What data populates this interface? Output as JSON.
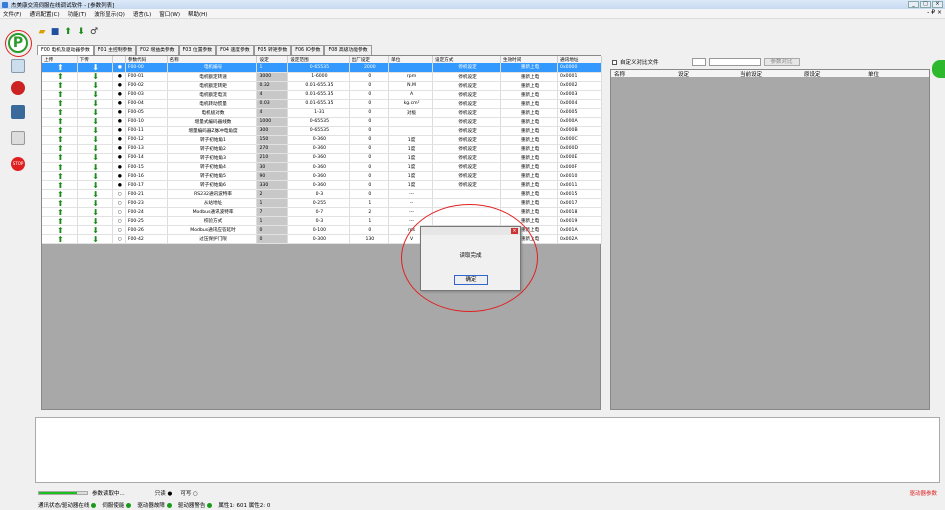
{
  "window": {
    "title": "杰美康交流伺服在线调试软件 - [参数列表]",
    "buttons": [
      "_",
      "□",
      "×"
    ]
  },
  "menu": [
    "文件(F)",
    "通讯配置(C)",
    "功能(T)",
    "波形显示(Q)",
    "语言(L)",
    "窗口(W)",
    "帮助(H)"
  ],
  "menu_right": "- ₽ ×",
  "tabs": [
    "F00 电机及驱动器参数",
    "F01 主控制参数",
    "F02 增益类参数",
    "F03 位置参数",
    "F04 速度参数",
    "F05 转矩参数",
    "F06 IO参数",
    "F08 高级功能参数"
  ],
  "columns": [
    "上传",
    "下传",
    "",
    "参数代码",
    "名称",
    "设定",
    "设定范围",
    "出厂设定",
    "单位",
    "设定方式",
    "生效时间",
    "通讯地址"
  ],
  "rows": [
    {
      "code": "F00-00",
      "name": "电机编号",
      "value": "1",
      "range": "0-65535",
      "default": "2000",
      "unit": "",
      "mode": "停机设定",
      "effect": "重新上电",
      "addr": "0x0000",
      "dot": "●"
    },
    {
      "code": "F00-01",
      "name": "电机额定转速",
      "value": "3000",
      "range": "1-6000",
      "default": "0",
      "unit": "rpm",
      "mode": "停机设定",
      "effect": "重新上电",
      "addr": "0x0001",
      "dot": "●"
    },
    {
      "code": "F00-02",
      "name": "电机额定转矩",
      "value": "0.32",
      "range": "0.01-655.35",
      "default": "0",
      "unit": "N.M",
      "mode": "停机设定",
      "effect": "重新上电",
      "addr": "0x0002",
      "dot": "●"
    },
    {
      "code": "F00-03",
      "name": "电机额定电流",
      "value": "4",
      "range": "0.01-655.35",
      "default": "0",
      "unit": "A",
      "mode": "停机设定",
      "effect": "重新上电",
      "addr": "0x0003",
      "dot": "●"
    },
    {
      "code": "F00-04",
      "name": "电机转动惯量",
      "value": "0.03",
      "range": "0.01-655.35",
      "default": "0",
      "unit": "kg.cm²",
      "mode": "停机设定",
      "effect": "重新上电",
      "addr": "0x0004",
      "dot": "●"
    },
    {
      "code": "F00-05",
      "name": "电机极对数",
      "value": "4",
      "range": "1-31",
      "default": "0",
      "unit": "对极",
      "mode": "停机设定",
      "effect": "重新上电",
      "addr": "0x0005",
      "dot": "●"
    },
    {
      "code": "F00-10",
      "name": "增量式编码器线数",
      "value": "1000",
      "range": "0-65535",
      "default": "0",
      "unit": "",
      "mode": "停机设定",
      "effect": "重新上电",
      "addr": "0x000A",
      "dot": "●"
    },
    {
      "code": "F00-11",
      "name": "增量编码器Z脉冲电角度",
      "value": "300",
      "range": "0-65535",
      "default": "0",
      "unit": "",
      "mode": "停机设定",
      "effect": "重新上电",
      "addr": "0x000B",
      "dot": "●"
    },
    {
      "code": "F00-12",
      "name": "转子初始角1",
      "value": "150",
      "range": "0-360",
      "default": "0",
      "unit": "1度",
      "mode": "停机设定",
      "effect": "重新上电",
      "addr": "0x000C",
      "dot": "●"
    },
    {
      "code": "F00-13",
      "name": "转子初始角2",
      "value": "270",
      "range": "0-360",
      "default": "0",
      "unit": "1度",
      "mode": "停机设定",
      "effect": "重新上电",
      "addr": "0x000D",
      "dot": "●"
    },
    {
      "code": "F00-14",
      "name": "转子初始角3",
      "value": "210",
      "range": "0-360",
      "default": "0",
      "unit": "1度",
      "mode": "停机设定",
      "effect": "重新上电",
      "addr": "0x000E",
      "dot": "●"
    },
    {
      "code": "F00-15",
      "name": "转子初始角4",
      "value": "30",
      "range": "0-360",
      "default": "0",
      "unit": "1度",
      "mode": "停机设定",
      "effect": "重新上电",
      "addr": "0x000F",
      "dot": "●"
    },
    {
      "code": "F00-16",
      "name": "转子初始角5",
      "value": "90",
      "range": "0-360",
      "default": "0",
      "unit": "1度",
      "mode": "停机设定",
      "effect": "重新上电",
      "addr": "0x0010",
      "dot": "●"
    },
    {
      "code": "F00-17",
      "name": "转子初始角6",
      "value": "330",
      "range": "0-360",
      "default": "0",
      "unit": "1度",
      "mode": "停机设定",
      "effect": "重新上电",
      "addr": "0x0011",
      "dot": "●"
    },
    {
      "code": "F00-21",
      "name": "RS232通讯波特率",
      "value": "2",
      "range": "0-3",
      "default": "0",
      "unit": "---",
      "mode": "",
      "effect": "重新上电",
      "addr": "0x0015",
      "dot": "○"
    },
    {
      "code": "F00-23",
      "name": "从站地址",
      "value": "1",
      "range": "0-255",
      "default": "1",
      "unit": "--",
      "mode": "",
      "effect": "重新上电",
      "addr": "0x0017",
      "dot": "○"
    },
    {
      "code": "F00-24",
      "name": "Modbus通讯波特率",
      "value": "7",
      "range": "0-7",
      "default": "2",
      "unit": "---",
      "mode": "",
      "effect": "重新上电",
      "addr": "0x0018",
      "dot": "○"
    },
    {
      "code": "F00-25",
      "name": "校验方式",
      "value": "1",
      "range": "0-3",
      "default": "1",
      "unit": "---",
      "mode": "",
      "effect": "重新上电",
      "addr": "0x0019",
      "dot": "○"
    },
    {
      "code": "F00-26",
      "name": "Modbus通讯应答延时",
      "value": "0",
      "range": "0-100",
      "default": "0",
      "unit": "ms",
      "mode": "",
      "effect": "重新上电",
      "addr": "0x001A",
      "dot": "○"
    },
    {
      "code": "F00-42",
      "name": "过压保护门限",
      "value": "0",
      "range": "0-300",
      "default": "130",
      "unit": "V",
      "mode": "",
      "effect": "重新上电",
      "addr": "0x002A",
      "dot": "○"
    }
  ],
  "right": {
    "checkbox_label": "自定义对比文件",
    "button": "参数对比",
    "columns": [
      "名称",
      "设定",
      "当前设定",
      "原设定",
      "单位"
    ]
  },
  "dialog": {
    "message": "读取完成",
    "ok": "确定"
  },
  "status": {
    "progress_label": "参数读取中...",
    "progress": 0.8,
    "read_label": "只读 ●",
    "write_label": "可写 ○",
    "alarm_text": "驱动器参数"
  },
  "status2": {
    "items": [
      "通讯状态/驱动器在线",
      "伺服使能",
      "驱动器故障",
      "驱动器警告"
    ],
    "counts": "属性1: 601  属性2: 0"
  },
  "sidebar": {
    "p_label": "P",
    "stop_label": "STOP"
  }
}
